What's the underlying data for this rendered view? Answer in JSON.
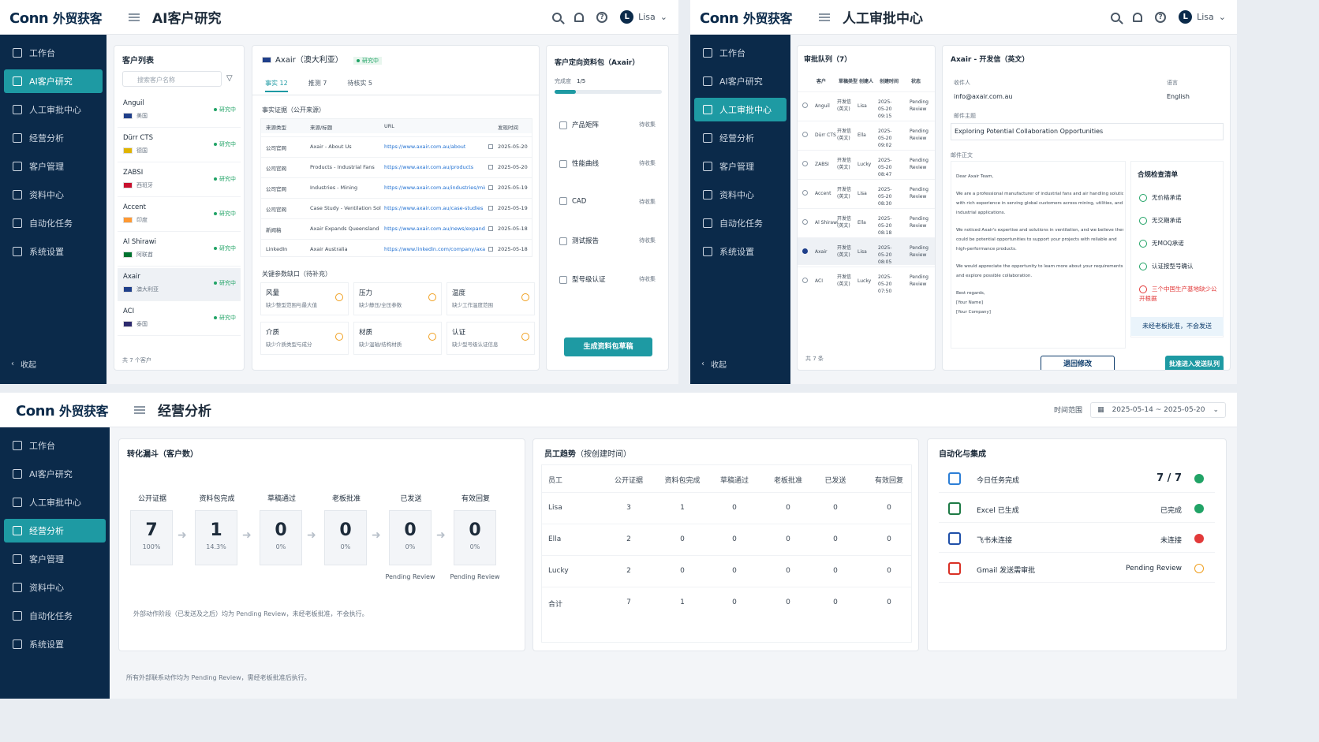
{
  "brand": {
    "logo_latin": "Conn",
    "logo_cn": "外贸获客"
  },
  "user": {
    "initial": "L",
    "name": "Lisa"
  },
  "nav": [
    "工作台",
    "AI客户研究",
    "人工审批中心",
    "经营分析",
    "客户管理",
    "资料中心",
    "自动化任务",
    "系统设置"
  ],
  "collapse": "收起",
  "research": {
    "title": "AI客户研究",
    "list_title": "客户列表",
    "search_placeholder": "搜索客户名称",
    "customers": [
      {
        "name": "Anguil",
        "country": "美国",
        "status": "研究中"
      },
      {
        "name": "Dürr CTS",
        "country": "德国",
        "status": "研究中"
      },
      {
        "name": "ZABSI",
        "country": "西班牙",
        "status": "研究中"
      },
      {
        "name": "Accent",
        "country": "印度",
        "status": "研究中"
      },
      {
        "name": "Al Shirawi",
        "country": "阿联酋",
        "status": "研究中"
      },
      {
        "name": "Axair",
        "country": "澳大利亚",
        "status": "研究中"
      },
      {
        "name": "ACI",
        "country": "泰国",
        "status": "研究中"
      }
    ],
    "list_footer": "共 7 个客户",
    "detail_name": "Axair（澳大利亚）",
    "detail_status": "研究中",
    "tabs": [
      "事实 12",
      "推测 7",
      "待核实 5"
    ],
    "evidence_title": "事实证据（公开来源）",
    "evidence_headers": [
      "来源类型",
      "来源/标题",
      "URL",
      "发现时间"
    ],
    "evidence": [
      [
        "公司官网",
        "Axair - About Us",
        "https://www.axair.com.au/about",
        "2025-05-20"
      ],
      [
        "公司官网",
        "Products - Industrial Fans",
        "https://www.axair.com.au/products",
        "2025-05-20"
      ],
      [
        "公司官网",
        "Industries - Mining",
        "https://www.axair.com.au/industries/mining",
        "2025-05-19"
      ],
      [
        "公司官网",
        "Case Study - Ventilation Solution",
        "https://www.axair.com.au/case-studies",
        "2025-05-19"
      ],
      [
        "新闻稿",
        "Axair Expands Queensland Facility",
        "https://www.axair.com.au/news/expands-qld",
        "2025-05-18"
      ],
      [
        "LinkedIn",
        "Axair Australia",
        "https://www.linkedin.com/company/axair",
        "2025-05-18"
      ]
    ],
    "gaps_title": "关键参数缺口（待补充）",
    "gaps": [
      {
        "t": "风量",
        "d": "缺少整型范围与最大值"
      },
      {
        "t": "压力",
        "d": "缺少静压/全压参数"
      },
      {
        "t": "温度",
        "d": "缺少工作温度范围"
      },
      {
        "t": "介质",
        "d": "缺少介质类型与成分"
      },
      {
        "t": "材质",
        "d": "缺少温轴/结构材质"
      },
      {
        "t": "认证",
        "d": "缺少型号级认证信息"
      }
    ],
    "pack_title": "客户定向资料包（Axair）",
    "progress_label": "完成度",
    "progress_text": "1/5",
    "progress": 0.2,
    "pack_items": [
      "产品矩阵",
      "性能曲线",
      "CAD",
      "测试报告",
      "型号级认证"
    ],
    "pack_state": "待收集",
    "generate": "生成资料包草稿"
  },
  "approval": {
    "title": "人工审批中心",
    "queue_title": "审批队列（7）",
    "headers": [
      "客户",
      "草稿类型",
      "创建人",
      "创建时间",
      "状态"
    ],
    "rows": [
      [
        "Anguil",
        "开发信(英文)",
        "Lisa",
        "2025-05-20 09:15",
        "Pending Review"
      ],
      [
        "Dürr CTS",
        "开发信(英文)",
        "Ella",
        "2025-05-20 09:02",
        "Pending Review"
      ],
      [
        "ZABSI",
        "开发信(英文)",
        "Lucky",
        "2025-05-20 08:47",
        "Pending Review"
      ],
      [
        "Accent",
        "开发信(英文)",
        "Lisa",
        "2025-05-20 08:30",
        "Pending Review"
      ],
      [
        "Al Shirawi",
        "开发信(英文)",
        "Ella",
        "2025-05-20 08:18",
        "Pending Review"
      ],
      [
        "Axair",
        "开发信(英文)",
        "Lisa",
        "2025-05-20 08:05",
        "Pending Review"
      ],
      [
        "ACI",
        "开发信(英文)",
        "Lucky",
        "2025-05-20 07:50",
        "Pending Review"
      ]
    ],
    "footer": "共 7 条",
    "mail_title": "Axair - 开发信（英文）",
    "to_label": "收件人",
    "to": "info@axair.com.au",
    "lang_label": "语言",
    "lang": "English",
    "subject_label": "邮件主题",
    "subject": "Exploring Potential Collaboration Opportunities",
    "body_label": "邮件正文",
    "body": [
      "Dear Axair Team,",
      "We are a professional manufacturer of industrial fans and air handling solutions",
      "with rich experience in serving global customers across mining, utilities, and",
      "industrial applications.",
      "We noticed Axair's expertise and solutions in ventilation, and we believe there",
      "could be potential opportunities to support your projects with reliable and",
      "high-performance products.",
      "We would appreciate the opportunity to learn more about your requirements",
      "and explore possible collaboration.",
      "Best regards,",
      "[Your Name]",
      "[Your Company]"
    ],
    "checklist_title": "合规检查清单",
    "checks": [
      "无价格承诺",
      "无交期承诺",
      "无MOQ承诺",
      "认证按型号确认"
    ],
    "warn": "三个中国生产基地缺少公开根据",
    "notice": "未经老板批准，不会发送",
    "reject": "退回修改",
    "approve": "批准进入发送队列"
  },
  "analytics": {
    "title": "经营分析",
    "range_label": "时间范围",
    "range": "2025-05-14 ~ 2025-05-20",
    "funnel_title": "转化漏斗（客户数）",
    "funnel": [
      {
        "label": "公开证据",
        "value": 7,
        "pct": "100%",
        "sub": ""
      },
      {
        "label": "资料包完成",
        "value": 1,
        "pct": "14.3%",
        "sub": ""
      },
      {
        "label": "草稿通过",
        "value": 0,
        "pct": "0%",
        "sub": ""
      },
      {
        "label": "老板批准",
        "value": 0,
        "pct": "0%",
        "sub": ""
      },
      {
        "label": "已发送",
        "value": 0,
        "pct": "0%",
        "sub": "Pending Review"
      },
      {
        "label": "有效回复",
        "value": 0,
        "pct": "0%",
        "sub": "Pending Review"
      }
    ],
    "funnel_note": "外部动作阶段（已发送及之后）均为 Pending Review，未经老板批准，不会执行。",
    "trend_title": "员工趋势",
    "trend_sub": "（按创建时间）",
    "trend_headers": [
      "员工",
      "公开证据",
      "资料包完成",
      "草稿通过",
      "老板批准",
      "已发送",
      "有效回复"
    ],
    "trend_rows": [
      [
        "Lisa",
        "3",
        "1",
        "0",
        "0",
        "0",
        "0"
      ],
      [
        "Ella",
        "2",
        "0",
        "0",
        "0",
        "0",
        "0"
      ],
      [
        "Lucky",
        "2",
        "0",
        "0",
        "0",
        "0",
        "0"
      ],
      [
        "合计",
        "7",
        "1",
        "0",
        "0",
        "0",
        "0"
      ]
    ],
    "auto_title": "自动化与集成",
    "auto": [
      {
        "name": "今日任务完成",
        "val": "7 / 7",
        "color": "#21a366"
      },
      {
        "name": "Excel 已生成",
        "val": "已完成",
        "color": "#21a366"
      },
      {
        "name": "飞书未连接",
        "val": "未连接",
        "color": "#e23a3a"
      },
      {
        "name": "Gmail 发送需审批",
        "val": "Pending Review",
        "color": "#f0a020"
      }
    ],
    "footer": "所有外部联系动作均为 Pending Review，需经老板批准后执行。"
  }
}
